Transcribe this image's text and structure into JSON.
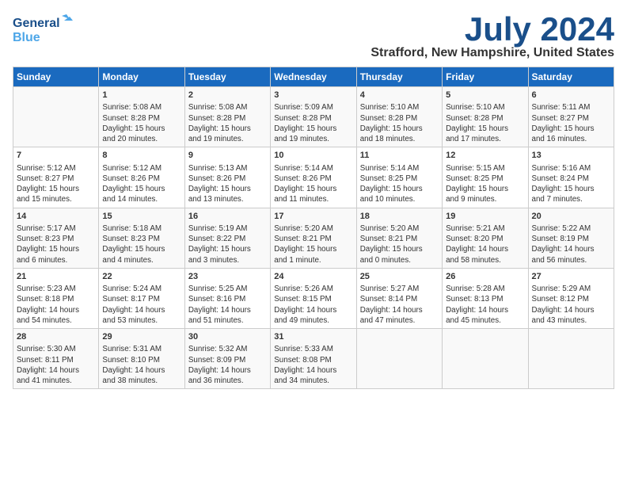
{
  "header": {
    "logo_general": "General",
    "logo_blue": "Blue",
    "main_title": "July 2024",
    "subtitle": "Strafford, New Hampshire, United States"
  },
  "calendar": {
    "days_of_week": [
      "Sunday",
      "Monday",
      "Tuesday",
      "Wednesday",
      "Thursday",
      "Friday",
      "Saturday"
    ],
    "weeks": [
      [
        {
          "num": "",
          "info": ""
        },
        {
          "num": "1",
          "info": "Sunrise: 5:08 AM\nSunset: 8:28 PM\nDaylight: 15 hours\nand 20 minutes."
        },
        {
          "num": "2",
          "info": "Sunrise: 5:08 AM\nSunset: 8:28 PM\nDaylight: 15 hours\nand 19 minutes."
        },
        {
          "num": "3",
          "info": "Sunrise: 5:09 AM\nSunset: 8:28 PM\nDaylight: 15 hours\nand 19 minutes."
        },
        {
          "num": "4",
          "info": "Sunrise: 5:10 AM\nSunset: 8:28 PM\nDaylight: 15 hours\nand 18 minutes."
        },
        {
          "num": "5",
          "info": "Sunrise: 5:10 AM\nSunset: 8:28 PM\nDaylight: 15 hours\nand 17 minutes."
        },
        {
          "num": "6",
          "info": "Sunrise: 5:11 AM\nSunset: 8:27 PM\nDaylight: 15 hours\nand 16 minutes."
        }
      ],
      [
        {
          "num": "7",
          "info": "Sunrise: 5:12 AM\nSunset: 8:27 PM\nDaylight: 15 hours\nand 15 minutes."
        },
        {
          "num": "8",
          "info": "Sunrise: 5:12 AM\nSunset: 8:26 PM\nDaylight: 15 hours\nand 14 minutes."
        },
        {
          "num": "9",
          "info": "Sunrise: 5:13 AM\nSunset: 8:26 PM\nDaylight: 15 hours\nand 13 minutes."
        },
        {
          "num": "10",
          "info": "Sunrise: 5:14 AM\nSunset: 8:26 PM\nDaylight: 15 hours\nand 11 minutes."
        },
        {
          "num": "11",
          "info": "Sunrise: 5:14 AM\nSunset: 8:25 PM\nDaylight: 15 hours\nand 10 minutes."
        },
        {
          "num": "12",
          "info": "Sunrise: 5:15 AM\nSunset: 8:25 PM\nDaylight: 15 hours\nand 9 minutes."
        },
        {
          "num": "13",
          "info": "Sunrise: 5:16 AM\nSunset: 8:24 PM\nDaylight: 15 hours\nand 7 minutes."
        }
      ],
      [
        {
          "num": "14",
          "info": "Sunrise: 5:17 AM\nSunset: 8:23 PM\nDaylight: 15 hours\nand 6 minutes."
        },
        {
          "num": "15",
          "info": "Sunrise: 5:18 AM\nSunset: 8:23 PM\nDaylight: 15 hours\nand 4 minutes."
        },
        {
          "num": "16",
          "info": "Sunrise: 5:19 AM\nSunset: 8:22 PM\nDaylight: 15 hours\nand 3 minutes."
        },
        {
          "num": "17",
          "info": "Sunrise: 5:20 AM\nSunset: 8:21 PM\nDaylight: 15 hours\nand 1 minute."
        },
        {
          "num": "18",
          "info": "Sunrise: 5:20 AM\nSunset: 8:21 PM\nDaylight: 15 hours\nand 0 minutes."
        },
        {
          "num": "19",
          "info": "Sunrise: 5:21 AM\nSunset: 8:20 PM\nDaylight: 14 hours\nand 58 minutes."
        },
        {
          "num": "20",
          "info": "Sunrise: 5:22 AM\nSunset: 8:19 PM\nDaylight: 14 hours\nand 56 minutes."
        }
      ],
      [
        {
          "num": "21",
          "info": "Sunrise: 5:23 AM\nSunset: 8:18 PM\nDaylight: 14 hours\nand 54 minutes."
        },
        {
          "num": "22",
          "info": "Sunrise: 5:24 AM\nSunset: 8:17 PM\nDaylight: 14 hours\nand 53 minutes."
        },
        {
          "num": "23",
          "info": "Sunrise: 5:25 AM\nSunset: 8:16 PM\nDaylight: 14 hours\nand 51 minutes."
        },
        {
          "num": "24",
          "info": "Sunrise: 5:26 AM\nSunset: 8:15 PM\nDaylight: 14 hours\nand 49 minutes."
        },
        {
          "num": "25",
          "info": "Sunrise: 5:27 AM\nSunset: 8:14 PM\nDaylight: 14 hours\nand 47 minutes."
        },
        {
          "num": "26",
          "info": "Sunrise: 5:28 AM\nSunset: 8:13 PM\nDaylight: 14 hours\nand 45 minutes."
        },
        {
          "num": "27",
          "info": "Sunrise: 5:29 AM\nSunset: 8:12 PM\nDaylight: 14 hours\nand 43 minutes."
        }
      ],
      [
        {
          "num": "28",
          "info": "Sunrise: 5:30 AM\nSunset: 8:11 PM\nDaylight: 14 hours\nand 41 minutes."
        },
        {
          "num": "29",
          "info": "Sunrise: 5:31 AM\nSunset: 8:10 PM\nDaylight: 14 hours\nand 38 minutes."
        },
        {
          "num": "30",
          "info": "Sunrise: 5:32 AM\nSunset: 8:09 PM\nDaylight: 14 hours\nand 36 minutes."
        },
        {
          "num": "31",
          "info": "Sunrise: 5:33 AM\nSunset: 8:08 PM\nDaylight: 14 hours\nand 34 minutes."
        },
        {
          "num": "",
          "info": ""
        },
        {
          "num": "",
          "info": ""
        },
        {
          "num": "",
          "info": ""
        }
      ]
    ]
  }
}
